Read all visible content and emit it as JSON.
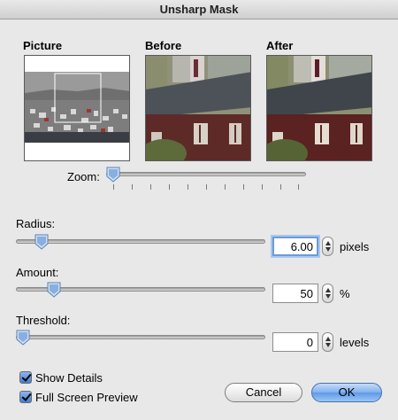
{
  "window": {
    "title": "Unsharp Mask"
  },
  "previews": {
    "picture_label": "Picture",
    "before_label": "Before",
    "after_label": "After"
  },
  "zoom": {
    "label": "Zoom:",
    "level": 0.0
  },
  "radius": {
    "label": "Radius:",
    "value": "6.00",
    "unit": "pixels",
    "slider_level": 0.08
  },
  "amount": {
    "label": "Amount:",
    "value": "50",
    "unit": "%",
    "slider_level": 0.13
  },
  "threshold": {
    "label": "Threshold:",
    "value": "0",
    "unit": "levels",
    "slider_level": 0.0
  },
  "options": {
    "show_details": {
      "label": "Show Details",
      "checked": true
    },
    "full_screen_preview": {
      "label": "Full Screen Preview",
      "checked": true
    }
  },
  "buttons": {
    "cancel": "Cancel",
    "ok": "OK"
  },
  "colors": {
    "accent": "#5f9ae8",
    "focus_ring": "#6c9bd8"
  }
}
